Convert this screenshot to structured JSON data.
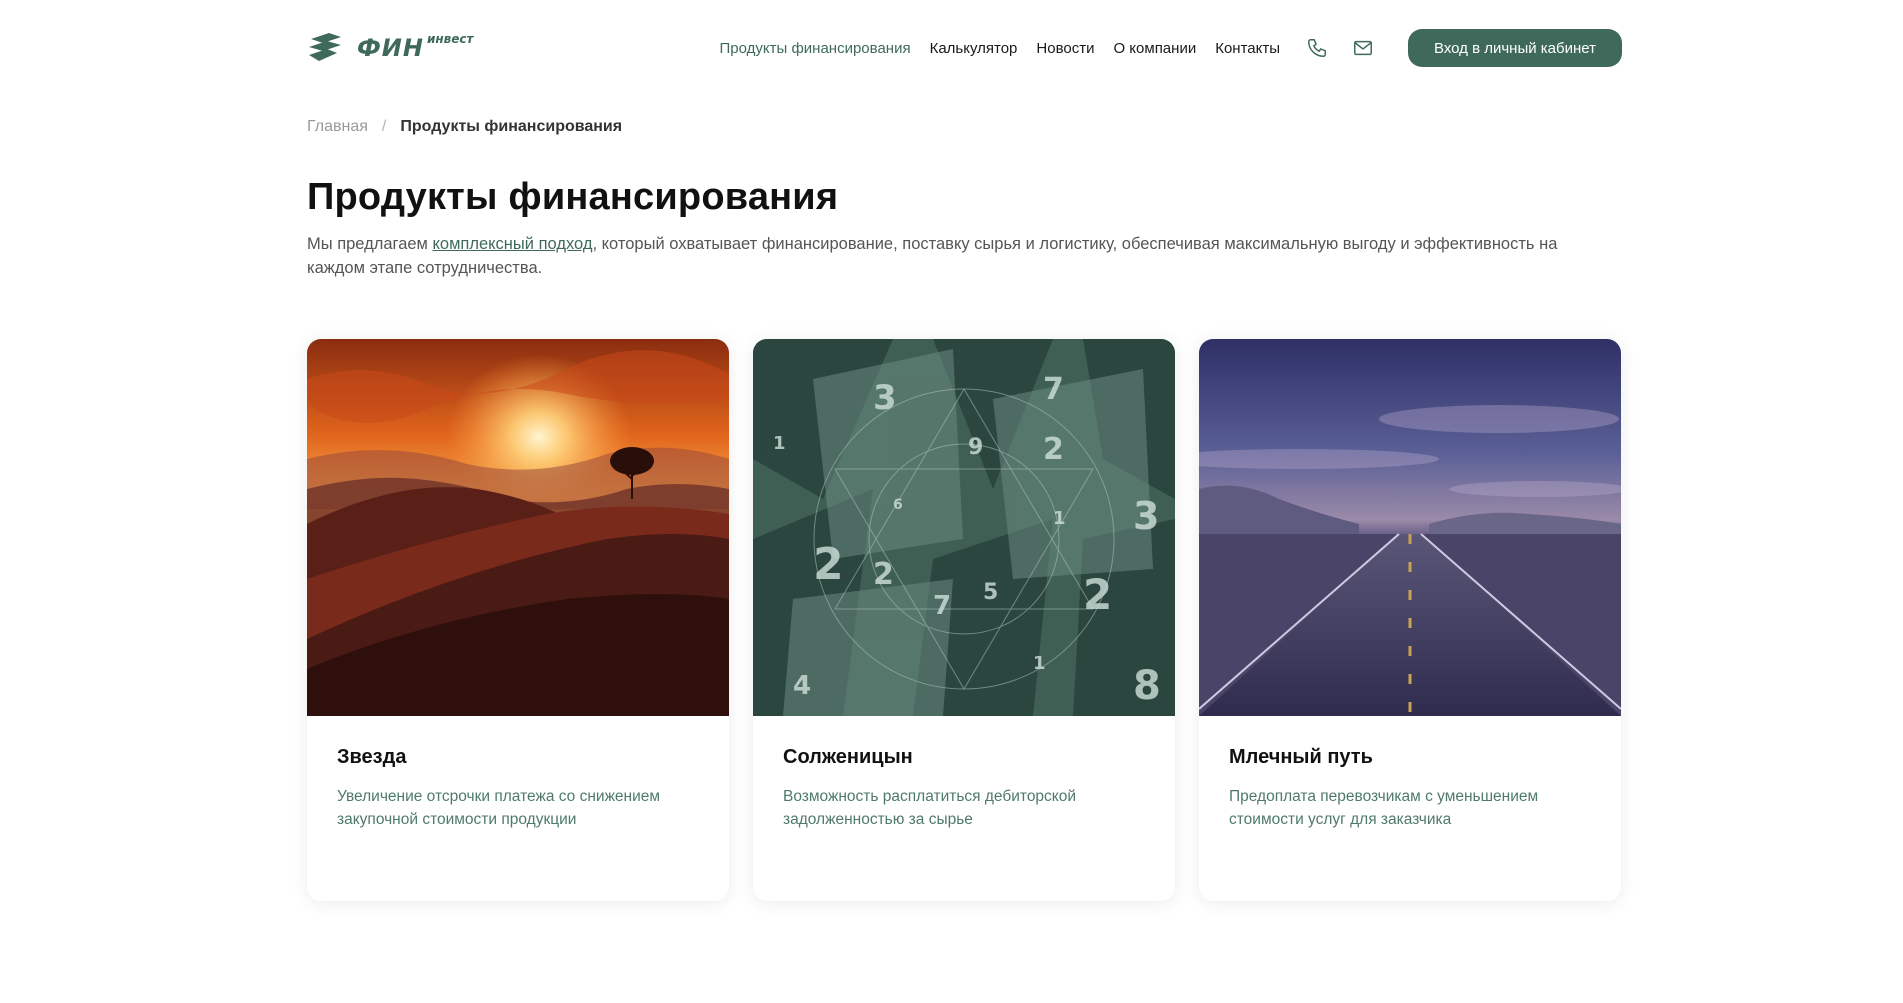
{
  "brand": {
    "name_main": "ФИН",
    "name_sup": "инвест",
    "color": "#3f6a5b"
  },
  "nav": {
    "items": [
      {
        "label": "Продукты финансирования",
        "active": true
      },
      {
        "label": "Калькулятор"
      },
      {
        "label": "Новости"
      },
      {
        "label": "О компании"
      },
      {
        "label": "Контакты"
      }
    ],
    "phone_icon": "phone-icon",
    "mail_icon": "mail-icon",
    "login_label": "Вход в личный кабинет"
  },
  "breadcrumb": {
    "home": "Главная",
    "separator": "/",
    "current": "Продукты финансирования"
  },
  "page": {
    "title": "Продукты финансирования",
    "intro_before": "Мы предлагаем ",
    "intro_link": "комплексный подход",
    "intro_after": ", который охватывает финансирование, поставку сырья и логистику, обеспечивая максимальную выгоду и эффективность на каждом этапе сотрудничества."
  },
  "cards": [
    {
      "title": "Звезда",
      "text": "Увеличение отсрочки платежа со снижением закупочной стоимости продукции",
      "image": "sunset-hill-tree"
    },
    {
      "title": "Солженицын",
      "text": "Возможность расплатиться дебиторской задолженностью за сырье",
      "image": "books-numbers"
    },
    {
      "title": "Млечный путь",
      "text": "Предоплата перевозчикам с уменьшением стоимости услуг для заказчика",
      "image": "desert-road"
    }
  ]
}
